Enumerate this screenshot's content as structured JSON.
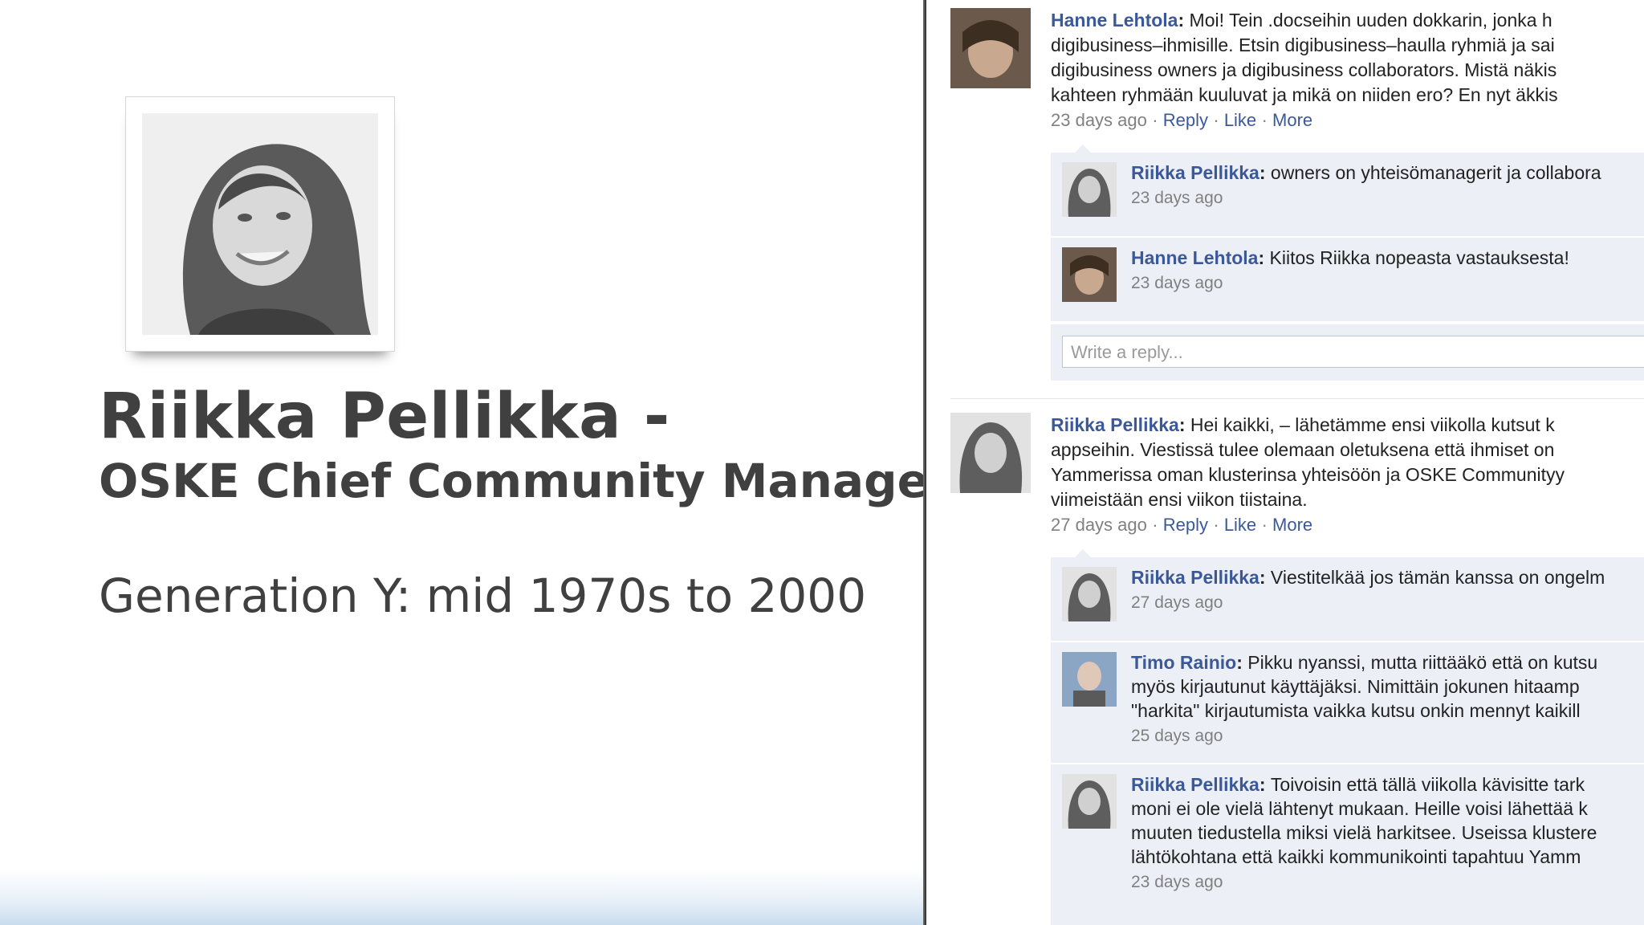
{
  "slide": {
    "name_line": "Riikka Pellikka -",
    "role_line": "OSKE Chief Community Manager",
    "generation_line": "Generation Y: mid 1970s to 2000"
  },
  "thread": {
    "posts": [
      {
        "author": "Hanne Lehtola",
        "lines": [
          "Moi! Tein .docseihin uuden dokkarin, jonka h",
          "digibusiness–ihmisille. Etsin digibusiness–haulla ryhmiä ja sai",
          "digibusiness owners ja digibusiness collaborators. Mistä näkis",
          "kahteen ryhmään kuuluvat ja mikä on niiden ero? En nyt äkkis"
        ],
        "time": "23 days ago",
        "actions": [
          "Reply",
          "Like",
          "More"
        ],
        "replies": [
          {
            "author": "Riikka Pellikka",
            "lines": [
              "owners on yhteisömanagerit ja collabora"
            ],
            "time": "23 days ago"
          },
          {
            "author": "Hanne Lehtola",
            "lines": [
              "Kiitos Riikka nopeasta vastauksesta!"
            ],
            "time": "23 days ago"
          }
        ],
        "reply_placeholder": "Write a reply..."
      },
      {
        "author": "Riikka Pellikka",
        "lines": [
          "Hei kaikki, – lähetämme ensi viikolla kutsut k",
          "appseihin. Viestissä tulee olemaan oletuksena että ihmiset on",
          "Yammerissa oman klusterinsa yhteisöön ja OSKE Communityy",
          "viimeistään ensi viikon tiistaina."
        ],
        "time": "27 days ago",
        "actions": [
          "Reply",
          "Like",
          "More"
        ],
        "replies": [
          {
            "author": "Riikka Pellikka",
            "lines": [
              "Viestitelkää jos tämän kanssa on ongelm"
            ],
            "time": "27 days ago"
          },
          {
            "author": "Timo Rainio",
            "lines": [
              "Pikku nyanssi, mutta riittääkö että on kutsu",
              "myös kirjautunut käyttäjäksi. Nimittäin jokunen hitaamp",
              "\"harkita\" kirjautumista vaikka kutsu onkin mennyt kaikill"
            ],
            "time": "25 days ago"
          },
          {
            "author": "Riikka Pellikka",
            "lines": [
              "Toivoisin että tällä viikolla kävisitte tark",
              "moni ei ole vielä lähtenyt mukaan. Heille voisi lähettää k",
              "muuten tiedustella miksi vielä harkitsee. Useissa klustere",
              "lähtökohtana että kaikki kommunikointi tapahtuu Yamm"
            ],
            "time": "23 days ago"
          }
        ]
      }
    ]
  }
}
